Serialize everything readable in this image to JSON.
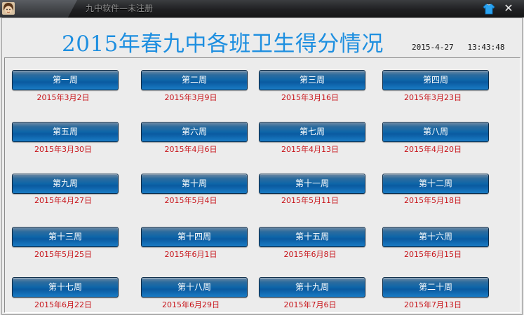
{
  "window": {
    "title": "九中软件—未注册",
    "close_glyph": "✕",
    "icons": [
      "app-avatar-icon",
      "skin-shirt-icon",
      "close-icon"
    ]
  },
  "header": {
    "title": "2015年春九中各班卫生得分情况",
    "date": "2015-4-27",
    "time": "13:43:48"
  },
  "colors": {
    "title_blue": "#1e8fe0",
    "date_red": "#c8141a",
    "button_blue": "#0e65a8"
  },
  "weeks": [
    {
      "label": "第一周",
      "date": "2015年3月2日"
    },
    {
      "label": "第二周",
      "date": "2015年3月9日"
    },
    {
      "label": "第三周",
      "date": "2015年3月16日"
    },
    {
      "label": "第四周",
      "date": "2015年3月23日"
    },
    {
      "label": "第五周",
      "date": "2015年3月30日"
    },
    {
      "label": "第六周",
      "date": "2015年4月6日"
    },
    {
      "label": "第七周",
      "date": "2015年4月13日"
    },
    {
      "label": "第八周",
      "date": "2015年4月20日"
    },
    {
      "label": "第九周",
      "date": "2015年4月27日"
    },
    {
      "label": "第十周",
      "date": "2015年5月4日"
    },
    {
      "label": "第十一周",
      "date": "2015年5月11日"
    },
    {
      "label": "第十二周",
      "date": "2015年5月18日"
    },
    {
      "label": "第十三周",
      "date": "2015年5月25日"
    },
    {
      "label": "第十四周",
      "date": "2015年6月1日"
    },
    {
      "label": "第十五周",
      "date": "2015年6月8日"
    },
    {
      "label": "第十六周",
      "date": "2015年6月15日"
    },
    {
      "label": "第十七周",
      "date": "2015年6月22日"
    },
    {
      "label": "第十八周",
      "date": "2015年6月29日"
    },
    {
      "label": "第十九周",
      "date": "2015年7月6日"
    },
    {
      "label": "第二十周",
      "date": "2015年7月13日"
    }
  ]
}
